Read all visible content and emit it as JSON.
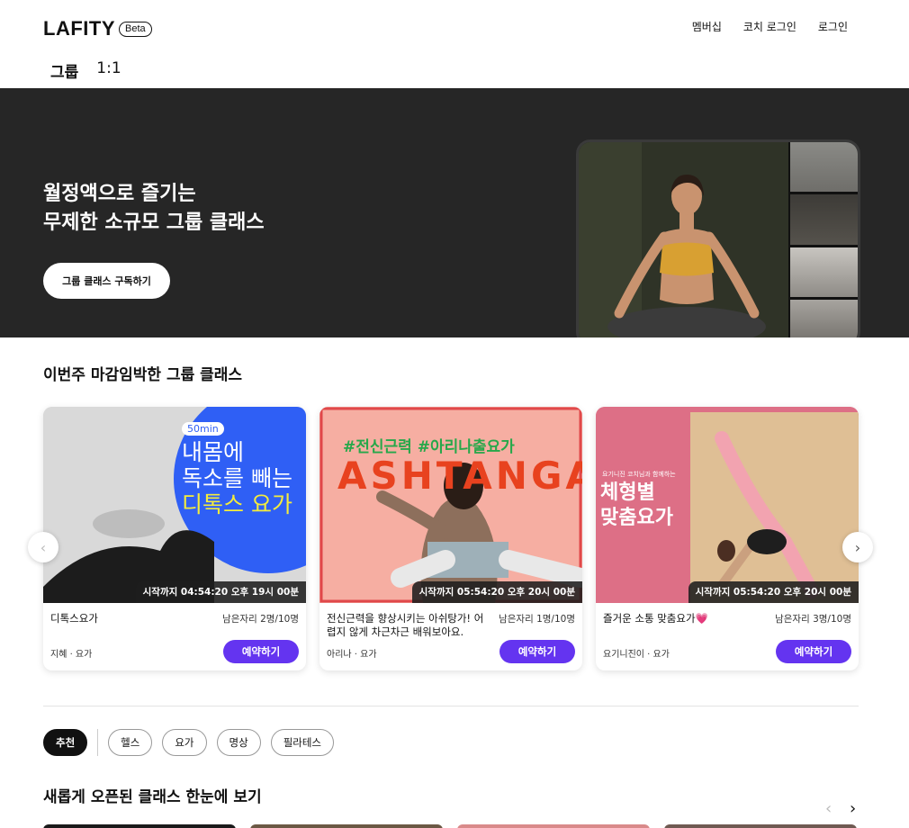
{
  "header": {
    "logo": "LAFITY",
    "badge": "Beta",
    "nav": [
      "멤버십",
      "코치 로그인",
      "로그인"
    ],
    "tabs": [
      "그룹",
      "1:1"
    ]
  },
  "hero": {
    "title_line1": "월정액으로 즐기는",
    "title_line2": "무제한 소규모 그룹 클래스",
    "button": "그룹 클래스 구독하기"
  },
  "section1": {
    "title": "이번주 마감임박한 그룹 클래스",
    "cards": [
      {
        "timer": "시작까지 04:54:20 오후 19시 00분",
        "title": "디톡스요가",
        "seats": "남은자리 2명/10명",
        "coach": "지혜 · 요가",
        "button": "예약하기",
        "img_badge": "50min",
        "img_line1": "내몸에",
        "img_line2": "독소를 빼는",
        "img_line3": "디톡스 요가"
      },
      {
        "timer": "시작까지 05:54:20 오후 20시 00분",
        "title": "전신근력을 향상시키는 아쉬탕가! 어렵지 않게 차근차근 배워보아요.",
        "seats": "남은자리 1명/10명",
        "coach": "아리나 · 요가",
        "button": "예약하기",
        "img_hashtag": "#전신근력 #아리나출요가",
        "img_big": "ASHTANGA"
      },
      {
        "timer": "시작까지 05:54:20 오후 20시 00분",
        "title": "즐거운 소통 맞춤요가💗",
        "seats": "남은자리 3명/10명",
        "coach": "요기니진이 · 요가",
        "button": "예약하기",
        "img_small": "요기니진 코치님과 함께하는",
        "img_line1": "체형별",
        "img_line2": "맞춤요가"
      }
    ]
  },
  "filters": [
    "추천",
    "헬스",
    "요가",
    "명상",
    "필라테스"
  ],
  "section2": {
    "title": "새롭게 오픈된 클래스 한눈에 보기"
  },
  "colors": {
    "accent": "#6434f0",
    "hero_bg": "#262626"
  },
  "icons": {
    "prev": "chevron-left-icon",
    "next": "chevron-right-icon"
  }
}
